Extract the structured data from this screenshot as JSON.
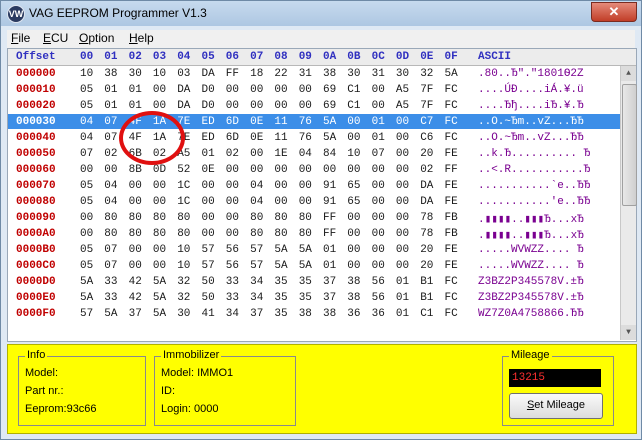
{
  "window": {
    "title": "VAG EEPROM Programmer V1.3",
    "app_icon_text": "VW",
    "close_label": "✕"
  },
  "menu": [
    "File",
    "ECU",
    "Option",
    "Help"
  ],
  "hex": {
    "header": {
      "offset": "Offset",
      "cols": [
        "00",
        "01",
        "02",
        "03",
        "04",
        "05",
        "06",
        "07",
        "08",
        "09",
        "0A",
        "0B",
        "0C",
        "0D",
        "0E",
        "0F"
      ],
      "ascii": "ASCII"
    },
    "selected_row": 3,
    "rows": [
      {
        "offset": "000000",
        "bytes": [
          "10",
          "38",
          "30",
          "10",
          "03",
          "DA",
          "FF",
          "18",
          "22",
          "31",
          "38",
          "30",
          "31",
          "30",
          "32",
          "5A"
        ],
        "ascii": ".80..Ђ\".\"1801Ѳ2Z"
      },
      {
        "offset": "000010",
        "bytes": [
          "05",
          "01",
          "01",
          "00",
          "DA",
          "D0",
          "00",
          "00",
          "00",
          "00",
          "69",
          "C1",
          "00",
          "A5",
          "7F",
          "FC"
        ],
        "ascii": "....ÚÐ....iÁ.¥.ü"
      },
      {
        "offset": "000020",
        "bytes": [
          "05",
          "01",
          "01",
          "00",
          "DA",
          "D0",
          "00",
          "00",
          "00",
          "00",
          "69",
          "C1",
          "00",
          "A5",
          "7F",
          "FC"
        ],
        "ascii": "....Ђђ....iЂ.¥.Ђ"
      },
      {
        "offset": "000030",
        "bytes": [
          "04",
          "07",
          "4F",
          "1A",
          "7E",
          "ED",
          "6D",
          "0E",
          "11",
          "76",
          "5A",
          "00",
          "01",
          "00",
          "C7",
          "FC"
        ],
        "ascii": "..O.~Ђm..vZ...ЂЂ"
      },
      {
        "offset": "000040",
        "bytes": [
          "04",
          "07",
          "4F",
          "1A",
          "7E",
          "ED",
          "6D",
          "0E",
          "11",
          "76",
          "5A",
          "00",
          "01",
          "00",
          "C6",
          "FC"
        ],
        "ascii": "..O.~Ђm..vZ...ЂЂ"
      },
      {
        "offset": "000050",
        "bytes": [
          "07",
          "02",
          "6B",
          "02",
          "A5",
          "01",
          "02",
          "00",
          "1E",
          "04",
          "84",
          "10",
          "07",
          "00",
          "20",
          "FE"
        ],
        "ascii": "..k.Ђ.......... Ђ"
      },
      {
        "offset": "000060",
        "bytes": [
          "00",
          "00",
          "8B",
          "0D",
          "52",
          "0E",
          "00",
          "00",
          "00",
          "00",
          "00",
          "00",
          "00",
          "00",
          "02",
          "FF"
        ],
        "ascii": "..<.R...........Ђ"
      },
      {
        "offset": "000070",
        "bytes": [
          "05",
          "04",
          "00",
          "00",
          "1C",
          "00",
          "00",
          "04",
          "00",
          "00",
          "91",
          "65",
          "00",
          "00",
          "DA",
          "FE"
        ],
        "ascii": "...........`e..ЂЂ"
      },
      {
        "offset": "000080",
        "bytes": [
          "05",
          "04",
          "00",
          "00",
          "1C",
          "00",
          "00",
          "04",
          "00",
          "00",
          "91",
          "65",
          "00",
          "00",
          "DA",
          "FE"
        ],
        "ascii": "...........'e..ЂЂ"
      },
      {
        "offset": "000090",
        "bytes": [
          "00",
          "80",
          "80",
          "80",
          "80",
          "00",
          "00",
          "80",
          "80",
          "80",
          "FF",
          "00",
          "00",
          "00",
          "78",
          "FB"
        ],
        "ascii": ".▮▮▮▮..▮▮▮Ђ...xЂ"
      },
      {
        "offset": "0000A0",
        "bytes": [
          "00",
          "80",
          "80",
          "80",
          "80",
          "00",
          "00",
          "80",
          "80",
          "80",
          "FF",
          "00",
          "00",
          "00",
          "78",
          "FB"
        ],
        "ascii": ".▮▮▮▮..▮▮▮Ђ...xЂ"
      },
      {
        "offset": "0000B0",
        "bytes": [
          "05",
          "07",
          "00",
          "00",
          "10",
          "57",
          "56",
          "57",
          "5A",
          "5A",
          "01",
          "00",
          "00",
          "00",
          "20",
          "FE"
        ],
        "ascii": ".....WVWZZ.... Ђ"
      },
      {
        "offset": "0000C0",
        "bytes": [
          "05",
          "07",
          "00",
          "00",
          "10",
          "57",
          "56",
          "57",
          "5A",
          "5A",
          "01",
          "00",
          "00",
          "00",
          "20",
          "FE"
        ],
        "ascii": ".....WVWZZ.... Ђ"
      },
      {
        "offset": "0000D0",
        "bytes": [
          "5A",
          "33",
          "42",
          "5A",
          "32",
          "50",
          "33",
          "34",
          "35",
          "35",
          "37",
          "38",
          "56",
          "01",
          "B1",
          "FC"
        ],
        "ascii": "Z3BZ2P345578V.±Ђ"
      },
      {
        "offset": "0000E0",
        "bytes": [
          "5A",
          "33",
          "42",
          "5A",
          "32",
          "50",
          "33",
          "34",
          "35",
          "35",
          "37",
          "38",
          "56",
          "01",
          "B1",
          "FC"
        ],
        "ascii": "Z3BZ2P345578V.±Ђ"
      },
      {
        "offset": "0000F0",
        "bytes": [
          "57",
          "5A",
          "37",
          "5A",
          "30",
          "41",
          "34",
          "37",
          "35",
          "38",
          "38",
          "36",
          "36",
          "01",
          "C1",
          "FC"
        ],
        "ascii": "WZ7Z0A4758866.ЂЂ"
      }
    ]
  },
  "info": {
    "title": "Info",
    "model": "Model:",
    "part": "Part nr.:",
    "eeprom": "Eeprom:93c66"
  },
  "immo": {
    "title": "Immobilizer",
    "model": "Model:  IMMO1",
    "id": "ID:",
    "login": "Login: 0000"
  },
  "mileage": {
    "title": "Mileage",
    "value": "13215",
    "button": "Set Mileage"
  },
  "colors": {
    "selection": "#3c8ee8",
    "panel": "#ffff00",
    "offset": "#c00000",
    "header": "#3030c0",
    "ascii": "#7a0090"
  }
}
